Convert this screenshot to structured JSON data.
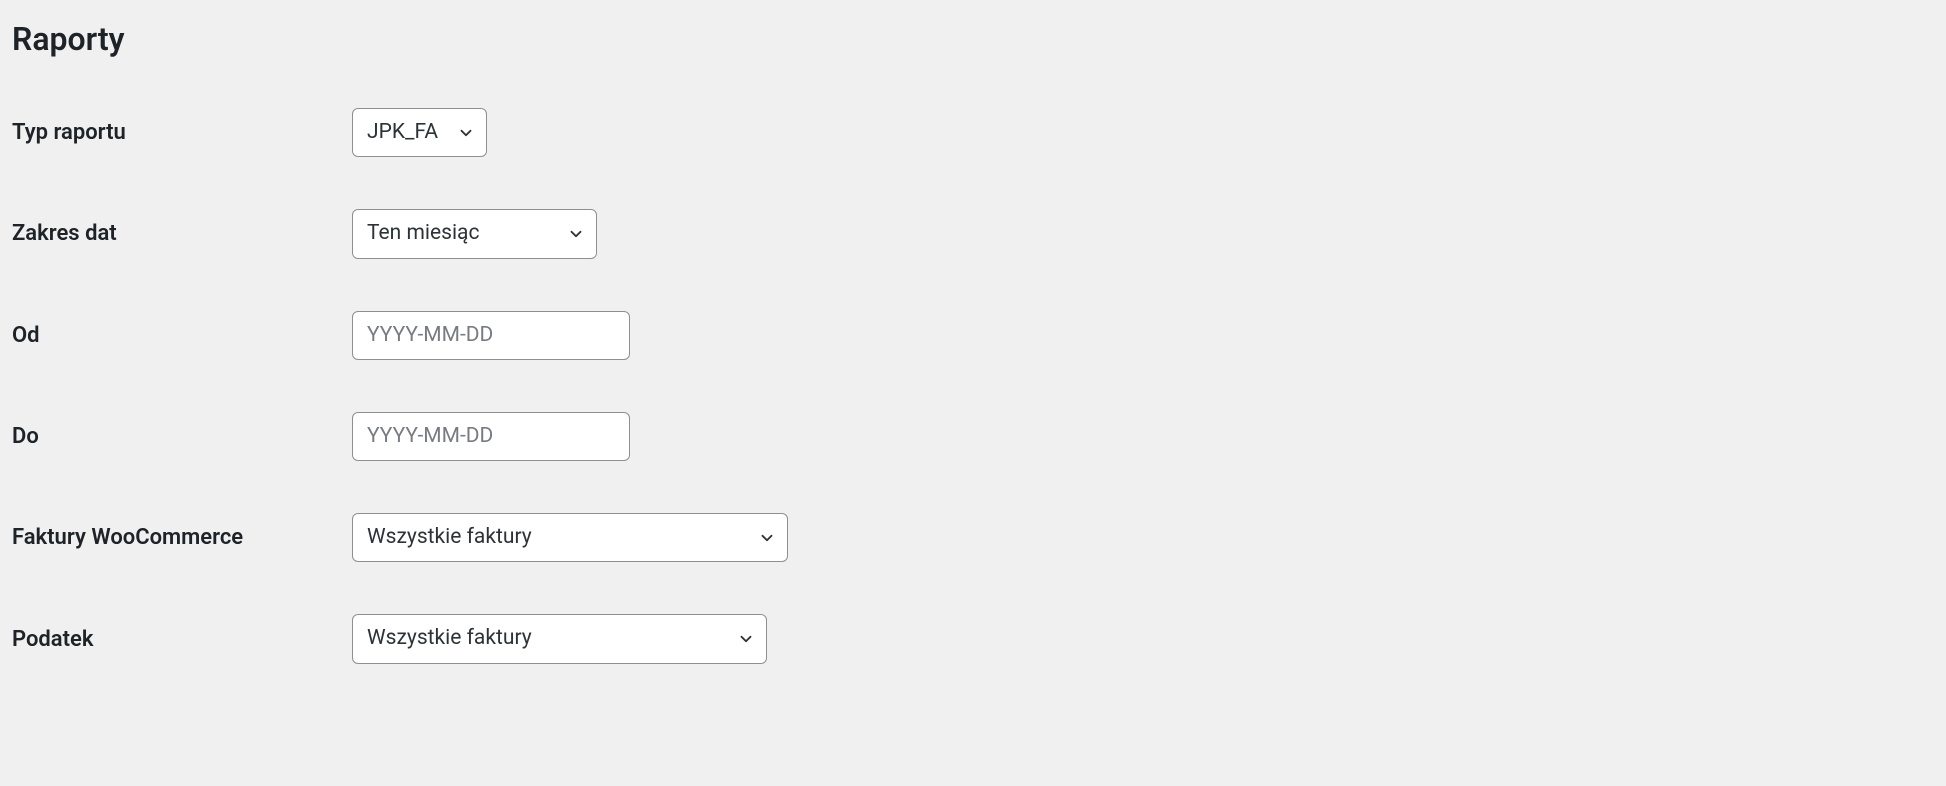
{
  "page": {
    "title": "Raporty"
  },
  "form": {
    "report_type": {
      "label": "Typ raportu",
      "value": "JPK_FA"
    },
    "date_range": {
      "label": "Zakres dat",
      "value": "Ten miesiąc"
    },
    "date_from": {
      "label": "Od",
      "placeholder": "YYYY-MM-DD",
      "value": ""
    },
    "date_to": {
      "label": "Do",
      "placeholder": "YYYY-MM-DD",
      "value": ""
    },
    "invoices": {
      "label": "Faktury WooCommerce",
      "value": "Wszystkie faktury"
    },
    "tax": {
      "label": "Podatek",
      "value": "Wszystkie faktury"
    }
  }
}
